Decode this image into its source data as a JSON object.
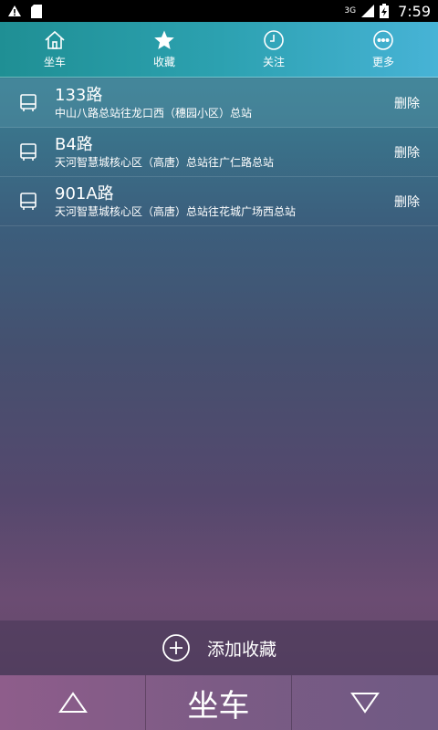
{
  "status_bar": {
    "network": "3G",
    "time": "7:59",
    "icons": [
      "warning-icon",
      "sd-card-icon",
      "signal-icon",
      "battery-icon"
    ]
  },
  "top_nav": {
    "tabs": [
      {
        "label": "坐车",
        "icon": "home-icon"
      },
      {
        "label": "收藏",
        "icon": "star-icon"
      },
      {
        "label": "关注",
        "icon": "clock-icon"
      },
      {
        "label": "更多",
        "icon": "more-icon"
      }
    ]
  },
  "favorites": [
    {
      "route": "133路",
      "desc": "中山八路总站往龙口西（穗园小区）总站",
      "delete": "删除"
    },
    {
      "route": "B4路",
      "desc": "天河智慧城核心区（高唐）总站往广仁路总站",
      "delete": "删除"
    },
    {
      "route": "901A路",
      "desc": "天河智慧城核心区（高唐）总站往花城广场西总站",
      "delete": "删除"
    }
  ],
  "add_bar": {
    "label": "添加收藏",
    "icon": "plus-circle-icon"
  },
  "bottom_bar": {
    "main_label": "坐车",
    "up_icon": "triangle-up-icon",
    "down_icon": "triangle-down-icon"
  },
  "colors": {
    "accent": "#2ca1b0",
    "bottom": "#7c5b85"
  }
}
